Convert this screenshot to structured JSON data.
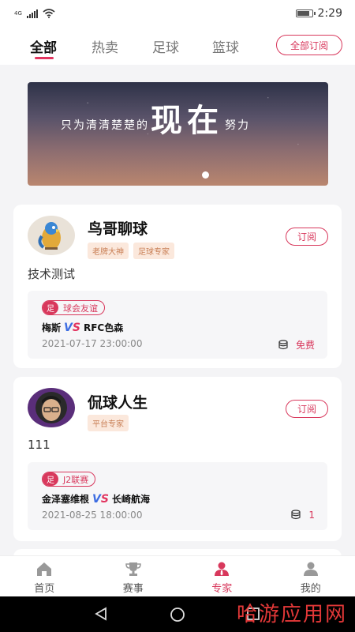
{
  "status_bar": {
    "network": "4G",
    "time": "2:29"
  },
  "tabs": [
    {
      "label": "全部",
      "active": true
    },
    {
      "label": "热卖",
      "active": false
    },
    {
      "label": "足球",
      "active": false
    },
    {
      "label": "篮球",
      "active": false
    }
  ],
  "subscribe_all_label": "全部订阅",
  "banner": {
    "text_before": "只为清清楚楚的",
    "text_big": "现在",
    "text_after": "努力"
  },
  "experts": [
    {
      "name": "鸟哥聊球",
      "tags": [
        "老牌大神",
        "足球专家"
      ],
      "subscribe_label": "订阅",
      "description": "技术测试",
      "match": {
        "sport_mark": "足",
        "league": "球会友谊",
        "home": "梅斯",
        "away": "RFC色森",
        "vs": "VS",
        "time": "2021-07-17 23:00:00",
        "price": "免费"
      }
    },
    {
      "name": "侃球人生",
      "tags": [
        "平台专家"
      ],
      "subscribe_label": "订阅",
      "description": "111",
      "match": {
        "sport_mark": "足",
        "league": "J2联赛",
        "home": "金泽塞维根",
        "away": "长崎航海",
        "vs": "VS",
        "time": "2021-08-25 18:00:00",
        "price": "1"
      }
    }
  ],
  "bottom_nav": [
    {
      "label": "首页",
      "icon": "home-icon"
    },
    {
      "label": "赛事",
      "icon": "trophy-icon"
    },
    {
      "label": "专家",
      "icon": "expert-icon",
      "active": true
    },
    {
      "label": "我的",
      "icon": "profile-icon"
    }
  ],
  "watermark": "哈游应用网",
  "colors": {
    "accent": "#d8385c",
    "tag_bg": "#fbe8dc",
    "tag_text": "#c98057",
    "vs_blue": "#3d6de2"
  }
}
